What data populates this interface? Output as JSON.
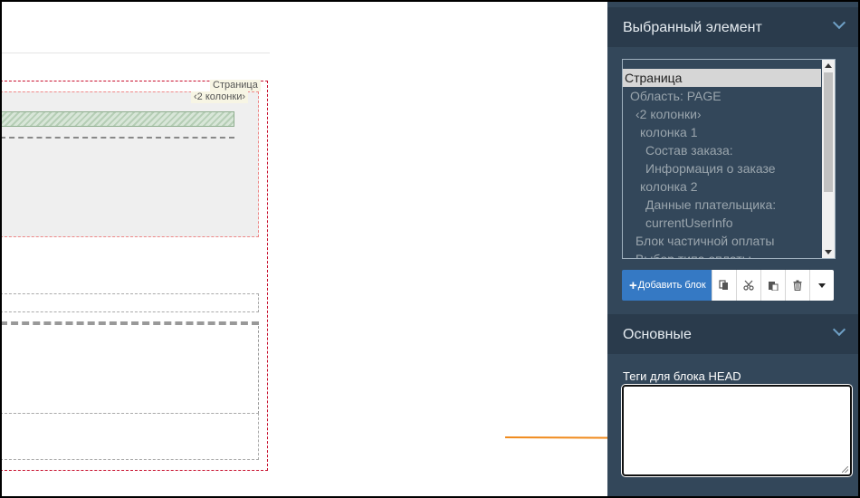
{
  "canvas": {
    "page_tag": "Страница",
    "columns_tag": "‹2 колонки›"
  },
  "panel": {
    "selected_section": {
      "title": "Выбранный элемент"
    },
    "tree": [
      {
        "label": "Страница",
        "indent": 0,
        "selected": true
      },
      {
        "label": "Область: PAGE",
        "indent": 1,
        "selected": false
      },
      {
        "label": "‹2 колонки›",
        "indent": 2,
        "selected": false
      },
      {
        "label": "колонка 1",
        "indent": 3,
        "selected": false
      },
      {
        "label": "Состав заказа:",
        "indent": 4,
        "selected": false
      },
      {
        "label": "Информация о заказе",
        "indent": 4,
        "selected": false
      },
      {
        "label": "колонка 2",
        "indent": 3,
        "selected": false
      },
      {
        "label": "Данные плательщика:",
        "indent": 4,
        "selected": false
      },
      {
        "label": "currentUserInfo",
        "indent": 4,
        "selected": false
      },
      {
        "label": "Блок частичной оплаты",
        "indent": 2,
        "selected": false
      },
      {
        "label": "Выбор типа оплаты",
        "indent": 2,
        "selected": false
      }
    ],
    "toolbar": {
      "add_block_label": "Добавить блок",
      "buttons": [
        "copy-icon",
        "cut-icon",
        "paste-icon",
        "trash-icon",
        "caret-down-icon"
      ]
    },
    "main_section": {
      "title": "Основные"
    },
    "head_tags": {
      "label": "Теги для блока HEAD",
      "value": ""
    }
  },
  "colors": {
    "panel_bg": "#33475a",
    "header_bg": "#2a3b4c",
    "accent": "#3579c4",
    "arrow": "#f08a1c",
    "page_outline": "#c8102e"
  }
}
